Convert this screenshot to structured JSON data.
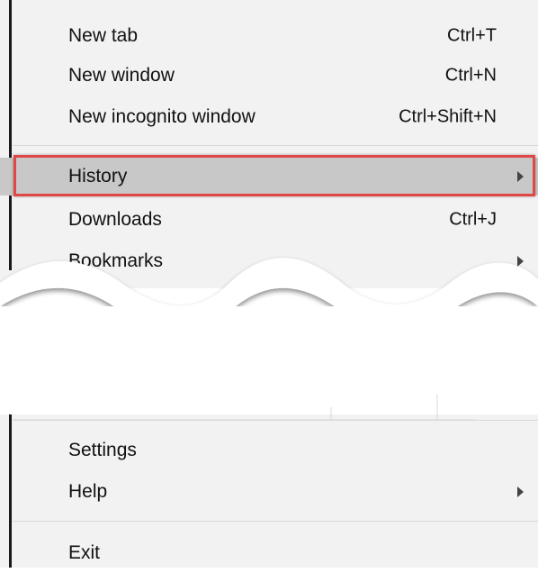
{
  "menu": {
    "new_tab": {
      "label": "New tab",
      "shortcut": "Ctrl+T"
    },
    "new_window": {
      "label": "New window",
      "shortcut": "Ctrl+N"
    },
    "new_incognito": {
      "label": "New incognito window",
      "shortcut": "Ctrl+Shift+N"
    },
    "history": {
      "label": "History"
    },
    "downloads": {
      "label": "Downloads",
      "shortcut": "Ctrl+J"
    },
    "bookmarks": {
      "label": "Bookmarks"
    },
    "settings": {
      "label": "Settings"
    },
    "help": {
      "label": "Help"
    },
    "exit": {
      "label": "Exit"
    }
  },
  "highlight_color": "#e04848",
  "menu_background": "#f2f2f2"
}
